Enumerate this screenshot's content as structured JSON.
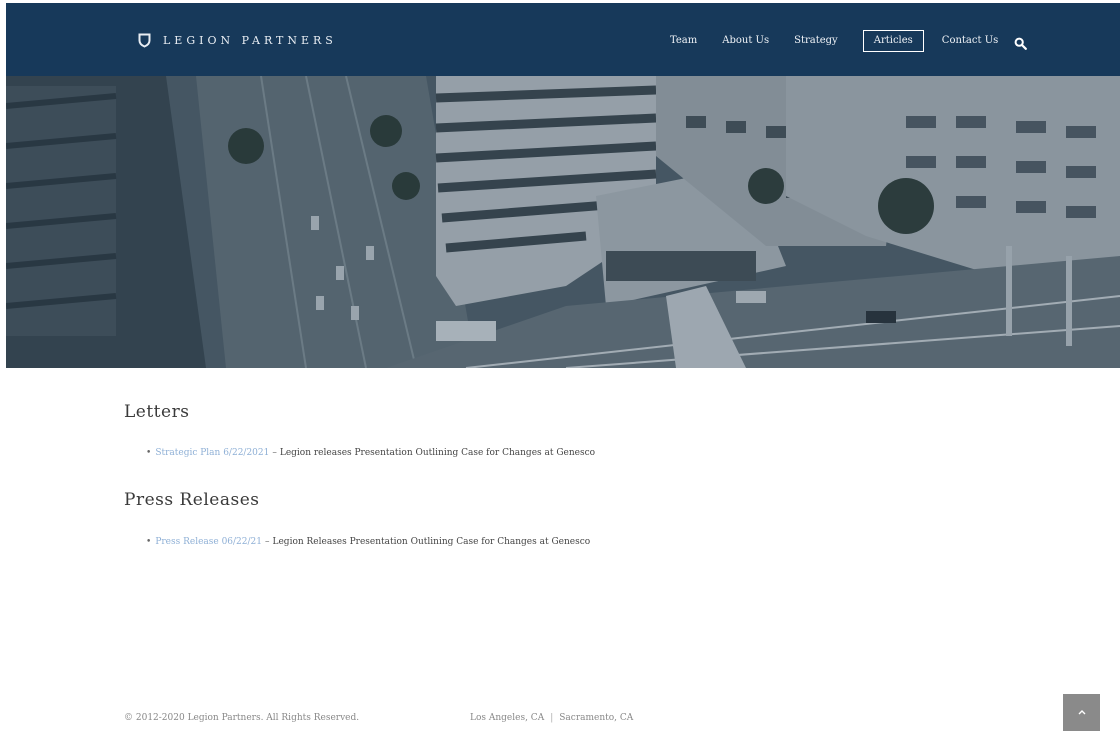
{
  "header": {
    "brand": "LEGION PARTNERS",
    "nav": [
      {
        "label": "Team"
      },
      {
        "label": "About Us"
      },
      {
        "label": "Strategy"
      },
      {
        "label": "Articles",
        "active": true
      },
      {
        "label": "Contact Us"
      }
    ],
    "search_icon": "search-icon",
    "background_color": "#17395a"
  },
  "sections": {
    "letters": {
      "title": "Letters",
      "items": [
        {
          "link_text": "Strategic Plan 6/22/2021",
          "separator": "–",
          "text": "Legion releases Presentation Outlining Case for Changes at Genesco"
        }
      ]
    },
    "press": {
      "title": "Press Releases",
      "items": [
        {
          "link_text": "Press Release 06/22/21",
          "separator": "–",
          "text": "Legion Releases Presentation Outlining Case for Changes at Genesco"
        }
      ]
    }
  },
  "footer": {
    "copyright": "© 2012-2020 Legion Partners. All Rights Reserved.",
    "locations": [
      "Los Angeles, CA",
      "Sacramento, CA"
    ],
    "location_separator": "|",
    "back_to_top_icon": "chevron-up-icon"
  }
}
